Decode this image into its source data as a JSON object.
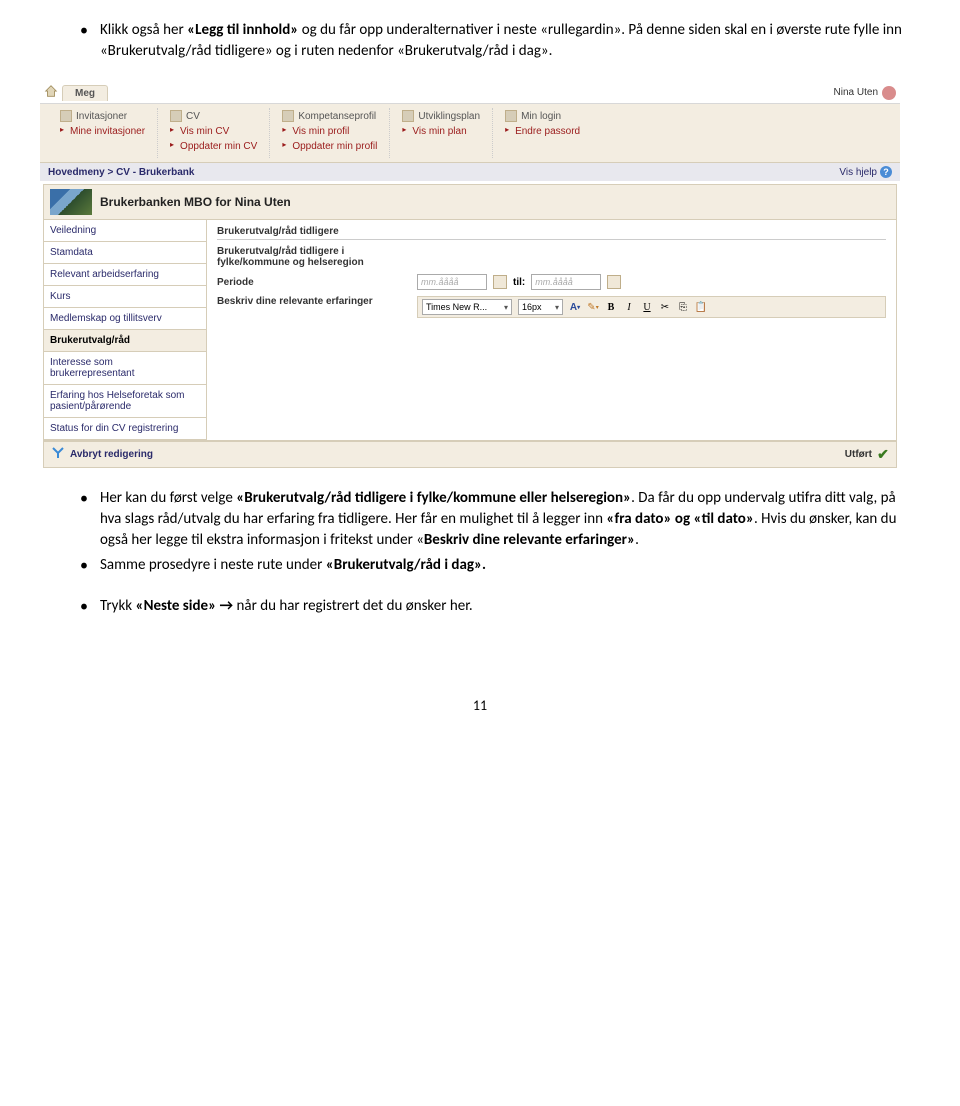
{
  "doc": {
    "bullets_top": [
      {
        "pre": "Klikk også her ",
        "b1": "«Legg til innhold» ",
        "post": "og du får opp underalternativer i neste «rullegardin». På denne siden skal en i øverste rute fylle inn «Brukerutvalg/råd tidligere» og i ruten nedenfor «Brukerutvalg/råd i dag»."
      }
    ],
    "bullets_bottom": [
      {
        "pre": "Her kan du først velge ",
        "b1": "«Brukerutvalg/råd tidligere i fylke/kommune eller helseregion»",
        "mid": ". Da får du opp undervalg utifra ditt valg, på hva slags råd/utvalg du har erfaring fra tidligere.  Her får en mulighet til å legger inn ",
        "b2": "«fra dato» og «til dato»",
        "post": ". Hvis du ønsker, kan du også her legge til ekstra informasjon i fritekst under «",
        "b3": "Beskriv dine relevante erfaringer»",
        "post2": "."
      },
      {
        "pre": "Samme prosedyre i neste rute under ",
        "b1": "«Brukerutvalg/råd i dag».",
        "post": ""
      }
    ],
    "last_bullet": {
      "pre": "Trykk ",
      "b1": "«Neste side» ",
      "arrow": "→ ",
      "post": "når du har registrert det du ønsker her."
    },
    "page_number": "11"
  },
  "ss": {
    "tab": "Meg",
    "user": "Nina Uten",
    "nav": [
      {
        "title": "Invitasjoner",
        "links": [
          "Mine invitasjoner"
        ]
      },
      {
        "title": "CV",
        "links": [
          "Vis min CV",
          "Oppdater min CV"
        ]
      },
      {
        "title": "Kompetanseprofil",
        "links": [
          "Vis min profil",
          "Oppdater min profil"
        ]
      },
      {
        "title": "Utviklingsplan",
        "links": [
          "Vis min plan"
        ]
      },
      {
        "title": "Min login",
        "links": [
          "Endre passord"
        ]
      }
    ],
    "breadcrumb": "Hovedmeny  >  CV - Brukerbank",
    "help": "Vis hjelp",
    "page_title": "Brukerbanken MBO for Nina Uten",
    "sidebar": [
      "Veiledning",
      "Stamdata",
      "Relevant arbeidserfaring",
      "Kurs",
      "Medlemskap og tillitsverv",
      "Brukerutvalg/råd",
      "Interesse som brukerrepresentant",
      "Erfaring hos Helseforetak som pasient/pårørende",
      "Status for din CV registrering"
    ],
    "active_sidebar_index": 5,
    "section_title": "Brukerutvalg/råd tidligere",
    "labels": {
      "l1": "Brukerutvalg/råd tidligere i fylke/kommune og helseregion",
      "l2": "Periode",
      "l3": "Beskriv dine relevante erfaringer"
    },
    "date": {
      "placeholder": "mm.åååå",
      "til": "til:"
    },
    "toolbar": {
      "font": "Times New R...",
      "size": "16px"
    },
    "footer": {
      "cancel": "Avbryt redigering",
      "done": "Utført"
    }
  }
}
